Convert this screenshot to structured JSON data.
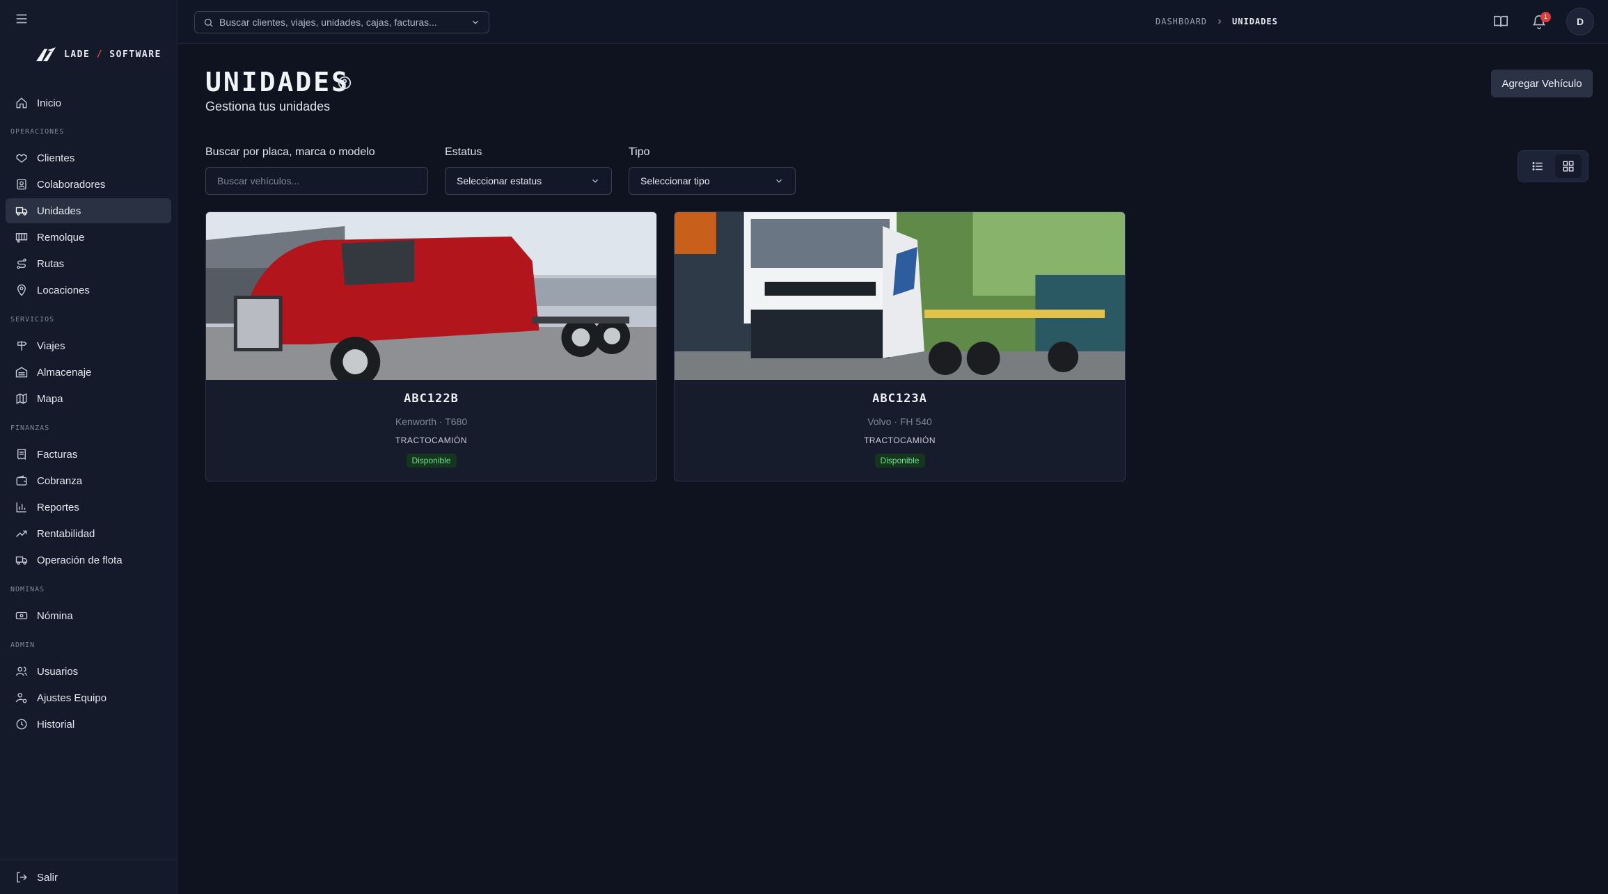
{
  "app": {
    "brand_left": "LADE",
    "brand_sep": "/",
    "brand_right": "SOFTWARE"
  },
  "sidebar": {
    "items": [
      {
        "label": "Inicio",
        "icon": "home-icon"
      },
      {
        "section": "OPERACIONES"
      },
      {
        "label": "Clientes",
        "icon": "handshake-icon"
      },
      {
        "label": "Colaboradores",
        "icon": "contact-icon"
      },
      {
        "label": "Unidades",
        "icon": "truck-icon",
        "active": true
      },
      {
        "label": "Remolque",
        "icon": "container-icon"
      },
      {
        "label": "Rutas",
        "icon": "route-icon"
      },
      {
        "label": "Locaciones",
        "icon": "map-pin-icon"
      },
      {
        "section": "SERVICIOS"
      },
      {
        "label": "Viajes",
        "icon": "signpost-icon"
      },
      {
        "label": "Almacenaje",
        "icon": "warehouse-icon"
      },
      {
        "label": "Mapa",
        "icon": "map-icon"
      },
      {
        "section": "FINANZAS"
      },
      {
        "label": "Facturas",
        "icon": "receipt-icon"
      },
      {
        "label": "Cobranza",
        "icon": "wallet-icon"
      },
      {
        "label": "Reportes",
        "icon": "bar-chart-icon"
      },
      {
        "label": "Rentabilidad",
        "icon": "trending-up-icon"
      },
      {
        "label": "Operación de flota",
        "icon": "fleet-icon"
      },
      {
        "section": "NOMINAS"
      },
      {
        "label": "Nómina",
        "icon": "banknote-icon"
      },
      {
        "section": "ADMIN"
      },
      {
        "label": "Usuarios",
        "icon": "users-icon"
      },
      {
        "label": "Ajustes Equipo",
        "icon": "user-cog-icon"
      },
      {
        "label": "Historial",
        "icon": "clock-icon"
      }
    ],
    "logout_label": "Salir"
  },
  "topbar": {
    "search_placeholder": "Buscar clientes, viajes, unidades, cajas, facturas...",
    "breadcrumb": [
      "DASHBOARD",
      "UNIDADES"
    ],
    "notifications_count": "1",
    "avatar_initial": "D"
  },
  "page": {
    "title": "UNIDADES",
    "subtitle": "Gestiona tus unidades",
    "add_button": "Agregar Vehículo"
  },
  "filters": {
    "search_label": "Buscar por placa, marca o modelo",
    "search_placeholder": "Buscar vehículos...",
    "status_label": "Estatus",
    "status_value": "Seleccionar estatus",
    "type_label": "Tipo",
    "type_value": "Seleccionar tipo"
  },
  "vehicles": [
    {
      "plate": "ABC122B",
      "model": "Kenworth · T680",
      "type": "TRACTOCAMIÓN",
      "status": "Disponible",
      "photo": "red-semi-truck"
    },
    {
      "plate": "ABC123A",
      "model": "Volvo · FH 540",
      "type": "TRACTOCAMIÓN",
      "status": "Disponible",
      "photo": "white-volvo-flatbed-truck"
    }
  ],
  "colors": {
    "status_ok": "#6fe08e",
    "accent": "#2b3246",
    "badge": "#e23b3b"
  }
}
